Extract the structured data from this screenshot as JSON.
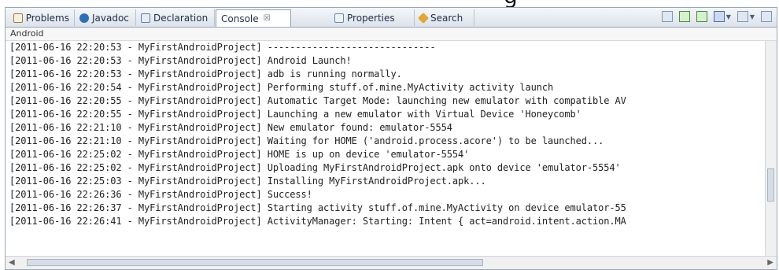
{
  "partial_title": "g",
  "tabs": [
    {
      "label": "Problems",
      "icon": "problems-icon"
    },
    {
      "label": "Javadoc",
      "icon": "javadoc-icon"
    },
    {
      "label": "Declaration",
      "icon": "declaration-icon"
    },
    {
      "label": "Console",
      "icon": "console-icon",
      "close": "☒"
    },
    {
      "label": "Properties",
      "icon": "properties-icon"
    },
    {
      "label": "Search",
      "icon": "search-icon"
    }
  ],
  "console_name": "Android",
  "lines": [
    "[2011-06-16 22:20:53 - MyFirstAndroidProject] ------------------------------",
    "[2011-06-16 22:20:53 - MyFirstAndroidProject] Android Launch!",
    "[2011-06-16 22:20:53 - MyFirstAndroidProject] adb is running normally.",
    "[2011-06-16 22:20:54 - MyFirstAndroidProject] Performing stuff.of.mine.MyActivity activity launch",
    "[2011-06-16 22:20:55 - MyFirstAndroidProject] Automatic Target Mode: launching new emulator with compatible AV",
    "[2011-06-16 22:20:55 - MyFirstAndroidProject] Launching a new emulator with Virtual Device 'Honeycomb'",
    "[2011-06-16 22:21:10 - MyFirstAndroidProject] New emulator found: emulator-5554",
    "[2011-06-16 22:21:10 - MyFirstAndroidProject] Waiting for HOME ('android.process.acore') to be launched...",
    "[2011-06-16 22:25:02 - MyFirstAndroidProject] HOME is up on device 'emulator-5554'",
    "[2011-06-16 22:25:02 - MyFirstAndroidProject] Uploading MyFirstAndroidProject.apk onto device 'emulator-5554'",
    "[2011-06-16 22:25:03 - MyFirstAndroidProject] Installing MyFirstAndroidProject.apk...",
    "[2011-06-16 22:26:36 - MyFirstAndroidProject] Success!",
    "[2011-06-16 22:26:37 - MyFirstAndroidProject] Starting activity stuff.of.mine.MyActivity on device emulator-55",
    "[2011-06-16 22:26:41 - MyFirstAndroidProject] ActivityManager: Starting: Intent { act=android.intent.action.MA"
  ]
}
